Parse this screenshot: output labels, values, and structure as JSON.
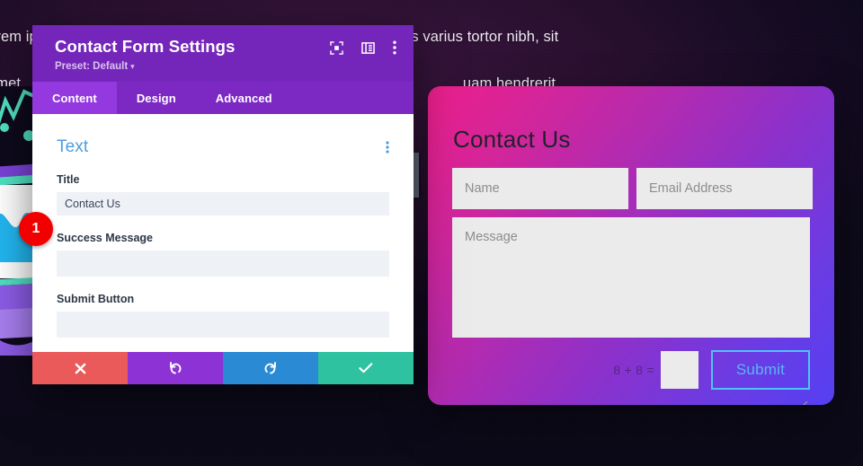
{
  "background": {
    "text_line1": "rem ipsum dolor sit amet, consectetur adipiscing elit. Maecenas varius tortor nibh, sit",
    "text_line2": "amet                                                                                                         uam hendrerit"
  },
  "modal": {
    "title": "Contact Form Settings",
    "preset_label": "Preset: Default",
    "preset_caret": "▾",
    "header_icons": [
      {
        "name": "focus-icon"
      },
      {
        "name": "layout-panel-icon"
      },
      {
        "name": "more-vertical-icon"
      }
    ],
    "tabs": [
      {
        "label": "Content",
        "active": true
      },
      {
        "label": "Design",
        "active": false
      },
      {
        "label": "Advanced",
        "active": false
      }
    ],
    "section": {
      "title": "Text",
      "options_icon": "more-vertical-icon"
    },
    "fields": [
      {
        "label": "Title",
        "value": "Contact Us",
        "placeholder": ""
      },
      {
        "label": "Success Message",
        "value": "",
        "placeholder": ""
      },
      {
        "label": "Submit Button",
        "value": "",
        "placeholder": ""
      }
    ],
    "footer": [
      {
        "name": "cancel-button",
        "icon": "close-icon",
        "color": "#eb5a5a"
      },
      {
        "name": "undo-button",
        "icon": "undo-icon",
        "color": "#8d33d6"
      },
      {
        "name": "redo-button",
        "icon": "redo-icon",
        "color": "#2a8ad4"
      },
      {
        "name": "save-button",
        "icon": "check-icon",
        "color": "#2ec2a0"
      }
    ]
  },
  "badge": {
    "number": "1"
  },
  "contact_form": {
    "title": "Contact Us",
    "name_placeholder": "Name",
    "email_placeholder": "Email Address",
    "message_placeholder": "Message",
    "captcha_question": "8 + 8 =",
    "captcha_value": "",
    "submit_label": "Submit",
    "gradient_start": "#ec1f8a",
    "gradient_end": "#5540f2",
    "submit_border_color": "#4fc3f7"
  }
}
